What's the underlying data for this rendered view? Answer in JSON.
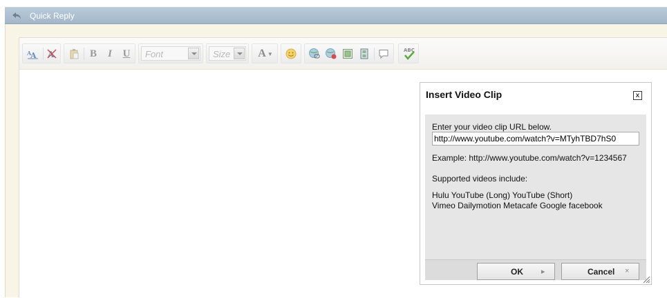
{
  "header": {
    "title": "Quick Reply",
    "icon": "reply-arrow-icon"
  },
  "toolbar": {
    "font_placeholder": "Font",
    "size_placeholder": "Size",
    "bold_label": "B",
    "italic_label": "I",
    "underline_label": "U",
    "font_color_label": "A",
    "spellcheck_label": "ABC"
  },
  "dialog": {
    "title": "Insert Video Clip",
    "close_label": "x",
    "url_label": "Enter your video clip URL below.",
    "url_value": "http://www.youtube.com/watch?v=MTyhTBD7hS0",
    "example": "Example: http://www.youtube.com/watch?v=1234567",
    "supported_title": "Supported videos include:",
    "supported_lines": [
      "Hulu YouTube (Long) YouTube (Short)",
      "Vimeo Dailymotion Metacafe Google facebook"
    ],
    "ok_label": "OK",
    "cancel_label": "Cancel"
  },
  "colors": {
    "header_bg": "#aebfcf",
    "panel_bg": "#f8f4e6",
    "dialog_body_bg": "#e6e6e6"
  }
}
